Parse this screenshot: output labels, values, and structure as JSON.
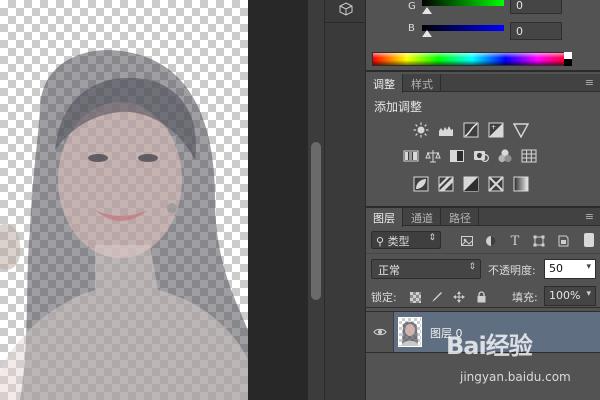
{
  "color_panel": {
    "sliders": [
      {
        "label": "G",
        "value": "0"
      },
      {
        "label": "B",
        "value": "0"
      }
    ]
  },
  "adjustments_panel": {
    "tabs": [
      "调整",
      "样式"
    ],
    "active_tab": "调整",
    "title": "添加调整",
    "icons": [
      "brightness-contrast-icon",
      "levels-icon",
      "curves-icon",
      "exposure-icon",
      "vibrance-icon",
      "hue-saturation-icon",
      "color-balance-icon",
      "black-white-icon",
      "photo-filter-icon",
      "channel-mixer-icon",
      "color-lookup-icon",
      "invert-icon",
      "posterize-icon",
      "threshold-icon",
      "selective-color-icon",
      "gradient-map-icon"
    ]
  },
  "layers_panel": {
    "tabs": [
      "图层",
      "通道",
      "路径"
    ],
    "active_tab": "图层",
    "filter_kind": "类型",
    "blend_mode": "正常",
    "opacity_label": "不透明度:",
    "opacity_value": "50",
    "lock_label": "锁定:",
    "fill_label": "填充:",
    "fill_value": "100%",
    "layers": [
      {
        "name": "图层 0",
        "visible": true,
        "selected": true
      }
    ]
  },
  "watermark": {
    "brand": "Bai经验",
    "url": "jingyan.baidu.com"
  },
  "colors": {
    "panel_bg": "#535353",
    "tab_bar": "#424242",
    "selected_layer": "#5f6e80",
    "pasteboard": "#282828"
  }
}
